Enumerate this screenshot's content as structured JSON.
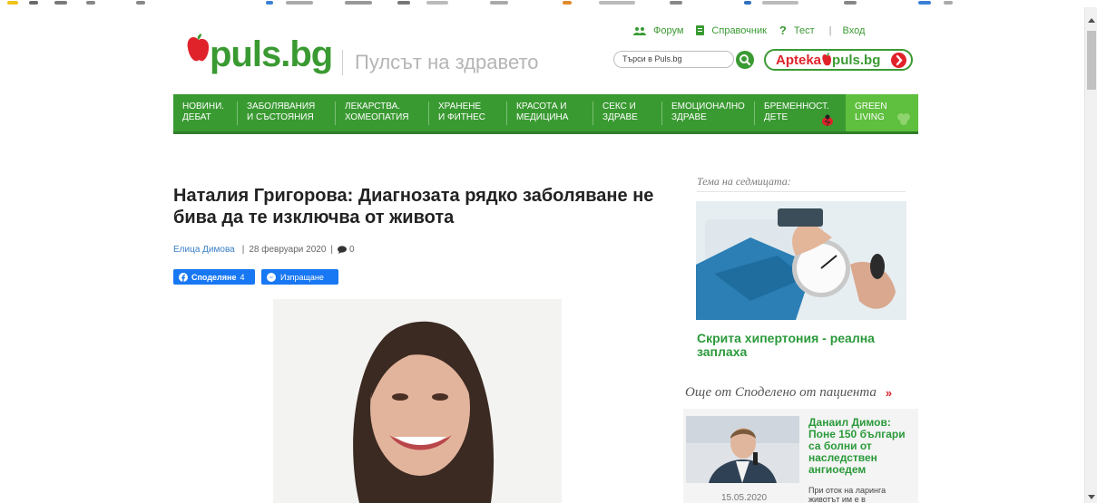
{
  "header": {
    "logo_text": "puls.bg",
    "tagline": "Пулсът на здравето",
    "top_links": {
      "forum": "Форум",
      "reference": "Справочник",
      "test": "Тест",
      "login": "Вход"
    },
    "search_placeholder": "Търси в Puls.bg",
    "apteka_part1": "Apteka",
    "apteka_part2": "puls.bg"
  },
  "nav": [
    {
      "line1": "НОВИНИ.",
      "line2": "ДЕБАТ"
    },
    {
      "line1": "ЗАБОЛЯВАНИЯ",
      "line2": "И СЪСТОЯНИЯ"
    },
    {
      "line1": "ЛЕКАРСТВА.",
      "line2": "ХОМЕОПАТИЯ"
    },
    {
      "line1": "ХРАНЕНЕ",
      "line2": "И ФИТНЕС"
    },
    {
      "line1": "КРАСОТА И",
      "line2": "МЕДИЦИНА"
    },
    {
      "line1": "СЕКС И",
      "line2": "ЗДРАВЕ"
    },
    {
      "line1": "ЕМОЦИОНАЛНО",
      "line2": "ЗДРАВЕ"
    },
    {
      "line1": "БРЕМЕННОСТ.",
      "line2": "ДЕТЕ"
    },
    {
      "line1": "GREEN",
      "line2": "LIVING"
    }
  ],
  "article": {
    "title": "Наталия Григорова: Диагнозата рядко заболяване не бива да те изключва от живота",
    "author": "Елица Димова",
    "date": "28 февруари 2020",
    "comments": "0",
    "share_label": "Споделяне",
    "share_count": "4",
    "send_label": "Изпращане"
  },
  "sidebar": {
    "week_label": "Тема на седмицата:",
    "week_title": "Скрита хипертония - реална заплаха",
    "more_heading": "Още от Споделено от пациента",
    "more_arrow": "»",
    "patient_title": "Данаил Димов: Поне 150 българи са болни от наследствен ангиоедем",
    "patient_text": "При оток на ларинга животът им е в",
    "patient_date": "15.05.2020"
  },
  "colors": {
    "brand_green": "#3a9a32",
    "accent_red": "#e0232b",
    "facebook_blue": "#1877f2"
  }
}
